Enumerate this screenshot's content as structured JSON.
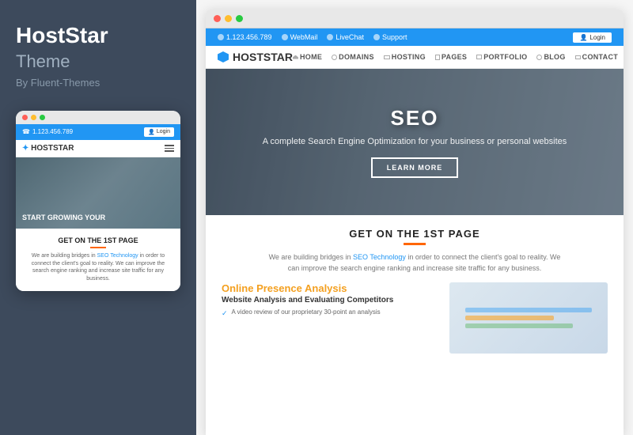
{
  "left": {
    "title": "HostStar",
    "subtitle": "Theme",
    "author": "By Fluent-Themes",
    "mobile_preview": {
      "phone_number": "1.123.456.789",
      "login_label": "Login",
      "logo_text_blue": "HOST",
      "logo_text_dark": "STAR",
      "hero_text": "START GROWING YOUR",
      "content_title": "GET ON THE 1ST PAGE",
      "content_text1": "We are building bridges in ",
      "content_seo_link": "SEO Technology",
      "content_text2": " in order to connect the client's goal to reality. We can improve the search engine ranking and increase site traffic for any business."
    }
  },
  "right": {
    "browser": {
      "topbar": {
        "phone": "1.123.456.789",
        "webmail": "WebMail",
        "livechat": "LiveChat",
        "support": "Support",
        "login": "Login"
      },
      "navbar": {
        "logo_blue": "HOST",
        "logo_dark": "STAR",
        "nav_items": [
          "HOME",
          "DOMAINS",
          "HOSTING",
          "PAGES",
          "PORTFOLIO",
          "BLOG",
          "CONTACT"
        ]
      },
      "hero": {
        "main_title": "SEO",
        "subtitle": "A complete Search Engine Optimization for your business or personal websites",
        "cta_label": "LEARN MORE"
      },
      "content": {
        "section_title": "GET ON THE 1ST PAGE",
        "desc_text1": "We are building bridges in ",
        "desc_seo_link": "SEO Technology",
        "desc_text2": " in order to connect the client's goal to reality. We can improve the search engine ranking and increase site traffic for any business.",
        "left_title_black": "Online ",
        "left_title_orange": "Presence Analysis",
        "feature_title": "Website Analysis and Evaluating Competitors",
        "feature_item": "A video review of our proprietary 30-point an analysis"
      }
    }
  }
}
